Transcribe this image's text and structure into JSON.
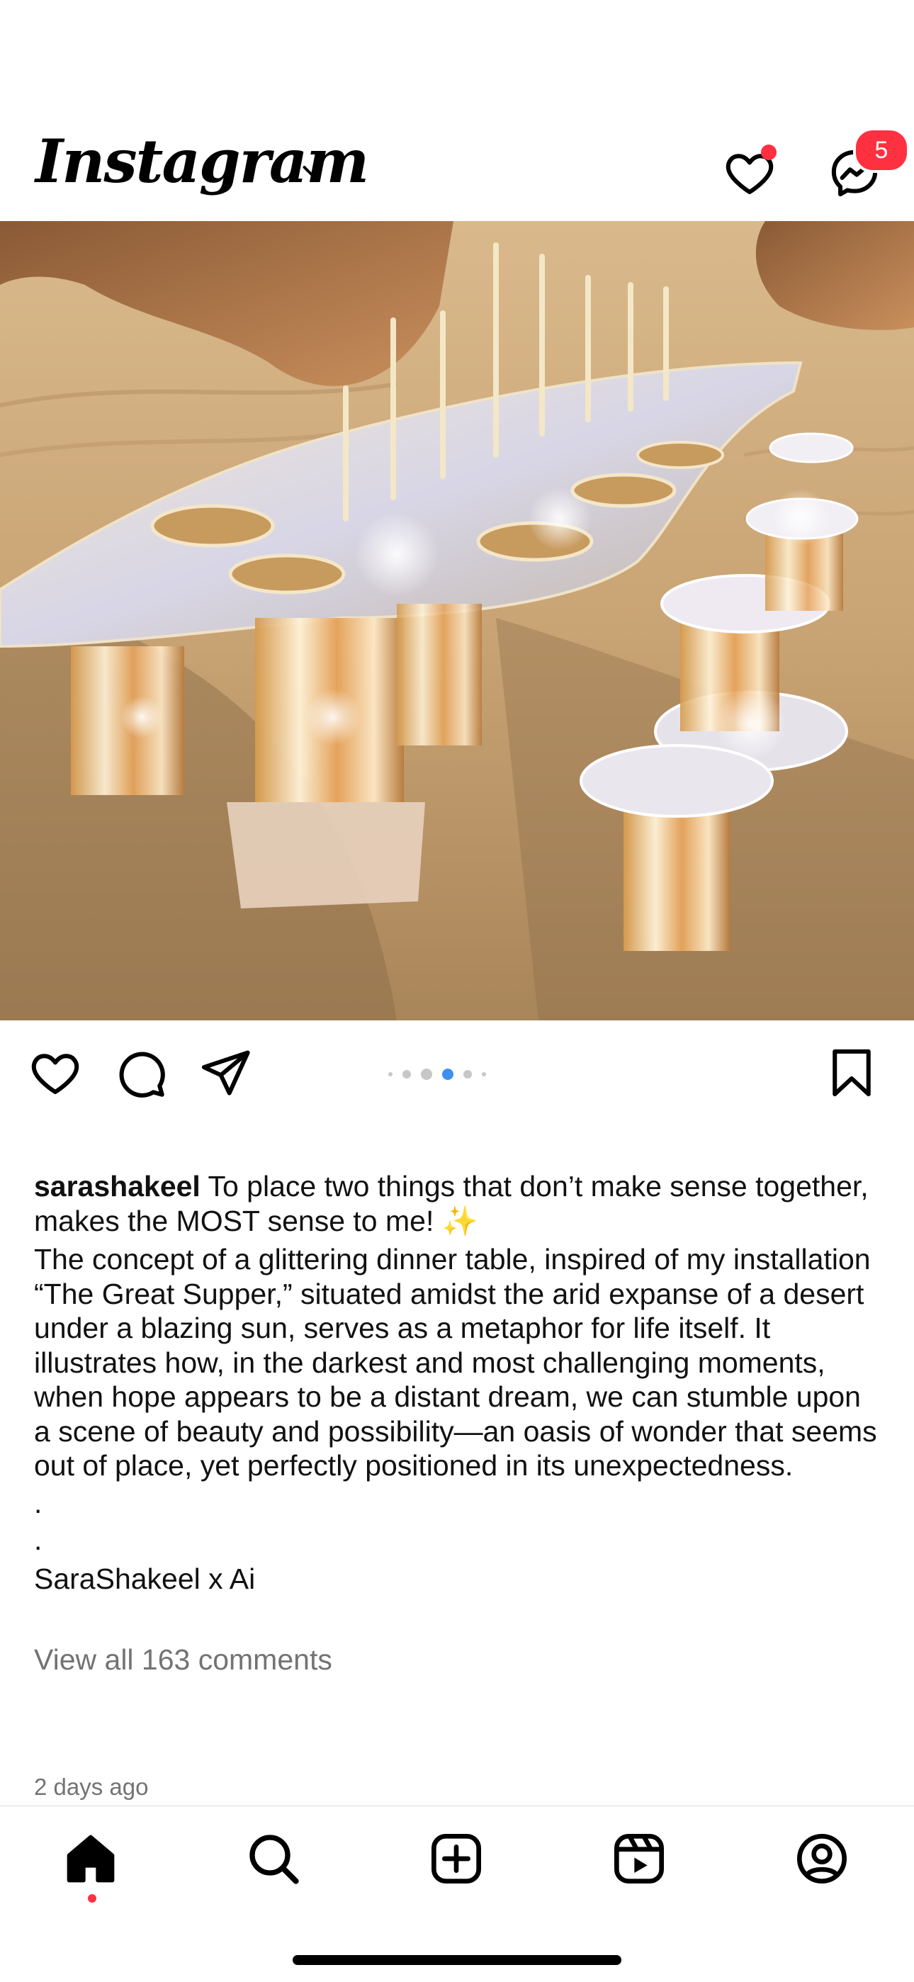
{
  "header": {
    "logo_text": "Instagram",
    "messages_badge": "5"
  },
  "post": {
    "carousel_count": 6,
    "active_index": 3,
    "username": "sarashakeel",
    "caption_first": "To place two things that don’t make sense together, makes the MOST sense to me!",
    "caption_emoji": "✨",
    "caption_body": "The concept of a glittering dinner table, inspired of my installation “The Great Supper,” situated amidst the arid expanse of a desert under a blazing sun, serves as a metaphor for life itself. It illustrates how, in the darkest and most challenging moments, when hope appears to be a distant dream, we can stumble upon a scene of beauty and possibility—an oasis of wonder that seems out of place, yet perfectly positioned in its unexpectedness.",
    "caption_dot1": ".",
    "caption_dot2": ".",
    "caption_credit": "SaraShakeel x Ai",
    "view_comments": "View all 163 comments",
    "timestamp": "2 days ago"
  },
  "colors": {
    "notification_red": "#ff3040",
    "carousel_active": "#3d8ff2",
    "secondary_text": "#737373"
  },
  "tabs": [
    "home-icon",
    "search-icon",
    "create-icon",
    "reels-icon",
    "profile-icon"
  ]
}
